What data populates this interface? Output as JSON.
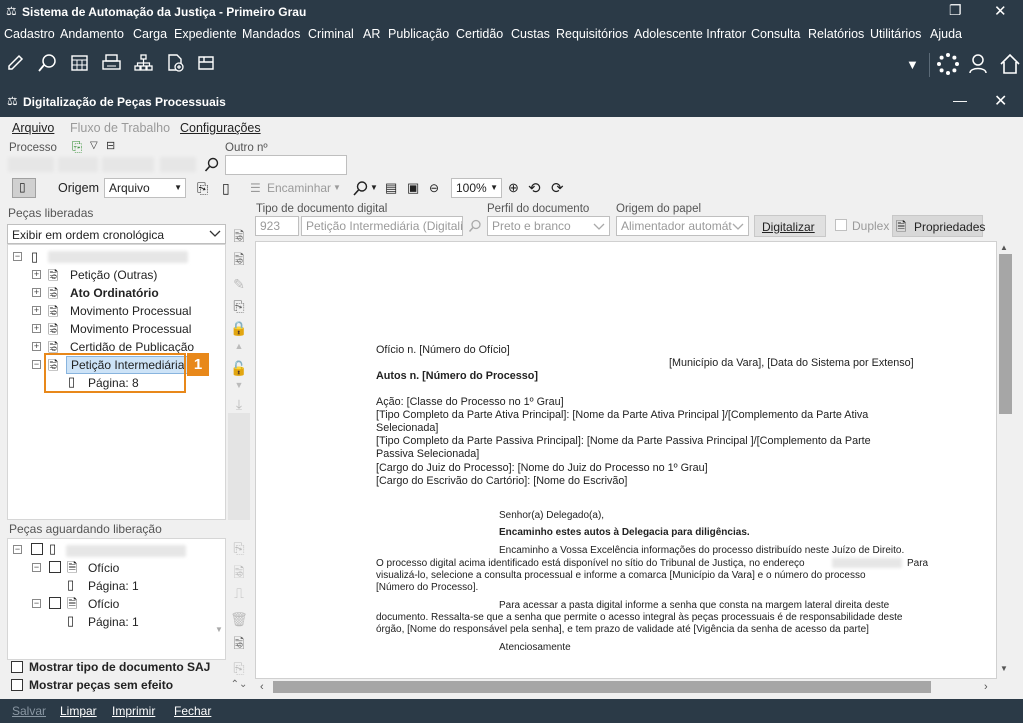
{
  "window": {
    "title": "Sistema de Automação da Justiça - Primeiro Grau",
    "restore_glyph": "❐",
    "close_glyph": "✕"
  },
  "menu": [
    "Cadastro",
    "Andamento",
    "Carga",
    "Expediente",
    "Mandados",
    "Criminal",
    "AR",
    "Publicação",
    "Certidão",
    "Custas",
    "Requisitórios",
    "Adolescente Infrator",
    "Consulta",
    "Relatórios",
    "Utilitários",
    "Ajuda"
  ],
  "subwindow": {
    "title": "Digitalização de Peças Processuais",
    "minimize_glyph": "—",
    "close_glyph": "✕"
  },
  "submenu": {
    "arquivo": "Arquivo",
    "fluxo": "Fluxo de Trabalho",
    "config": "Configurações"
  },
  "process": {
    "label": "Processo",
    "outro_label": "Outro nº"
  },
  "tools": {
    "origem_label": "Origem",
    "origem_value": "Arquivo",
    "encaminhar": "Encaminhar",
    "zoom": "100%"
  },
  "left": {
    "liberadas_title": "Peças liberadas",
    "order_select": "Exibir em ordem cronológica",
    "tree": [
      "Petição (Outras)",
      "Ato Ordinatório",
      "Movimento Processual",
      "Movimento Processual",
      "Certidão de Publicação",
      "Petição Intermediária"
    ],
    "page_item": "Página: 8",
    "callout_number": "1",
    "aguardando_title": "Peças aguardando liberação",
    "pending": [
      {
        "label": "Ofício",
        "page": "Página: 1"
      },
      {
        "label": "Ofício",
        "page": "Página: 1"
      }
    ],
    "opt_tipo": "Mostrar tipo de documento SAJ",
    "opt_sem_efeito": "Mostrar peças sem efeito"
  },
  "fields": {
    "tipo_label": "Tipo de documento digital",
    "tipo_code": "923",
    "tipo_name": "Petição Intermediária (Digitaliz",
    "perfil_label": "Perfil do documento",
    "perfil_value": "Preto e branco",
    "origem_papel_label": "Origem do papel",
    "origem_papel_value": "Alimentador automát",
    "digitalizar": "Digitalizar",
    "duplex": "Duplex",
    "propriedades": "Propriedades"
  },
  "document": {
    "l1": "Ofício n. [Número do Ofício]",
    "l2": "[Município da Vara], [Data do Sistema por Extenso]",
    "l3": "Autos n. [Número do Processo]",
    "l4": "Ação: [Classe do Processo no 1º Grau]",
    "l5a": "[Tipo Completo da Parte Ativa Principal]: [Nome da Parte Ativa Principal ]/[Complemento da Parte Ativa",
    "l5b": "Selecionada]",
    "l6a": "[Tipo Completo da Parte Passiva Principal]: [Nome da Parte Passiva Principal ]/[Complemento da Parte",
    "l6b": "Passiva Selecionada]",
    "l7": "[Cargo do Juiz do Processo]: [Nome do Juiz do Processo no 1º Grau]",
    "l8": "[Cargo do Escrivão do Cartório]: [Nome do Escrivão]",
    "l9": "Senhor(a) Delegado(a),",
    "l10": "Encaminho estes autos à Delegacia para diligências.",
    "l11": "Encaminho a Vossa Excelência informações do processo distribuído neste Juízo de Direito.",
    "l12a": "O processo digital acima identificado está disponível no sítio do Tribunal de Justiça, no endereço",
    "l12a2": "Para",
    "l12b": "visualizá-lo, selecione a consulta processual e informe a comarca  [Município da Vara] e o número do processo",
    "l12c": "[Número do Processo].",
    "l13a": "Para acessar a pasta digital informe a senha que consta na margem lateral direita deste",
    "l13b": "documento. Ressalta-se que a senha que permite o acesso integral às peças processuais é de responsabilidade deste",
    "l13c": "órgão, [Nome do responsável pela senha], e tem prazo de validade até [Vigência da senha de acesso da parte]",
    "l14": "Atenciosamente"
  },
  "status": {
    "salvar": "Salvar",
    "limpar": "Limpar",
    "imprimir": "Imprimir",
    "fechar": "Fechar"
  }
}
